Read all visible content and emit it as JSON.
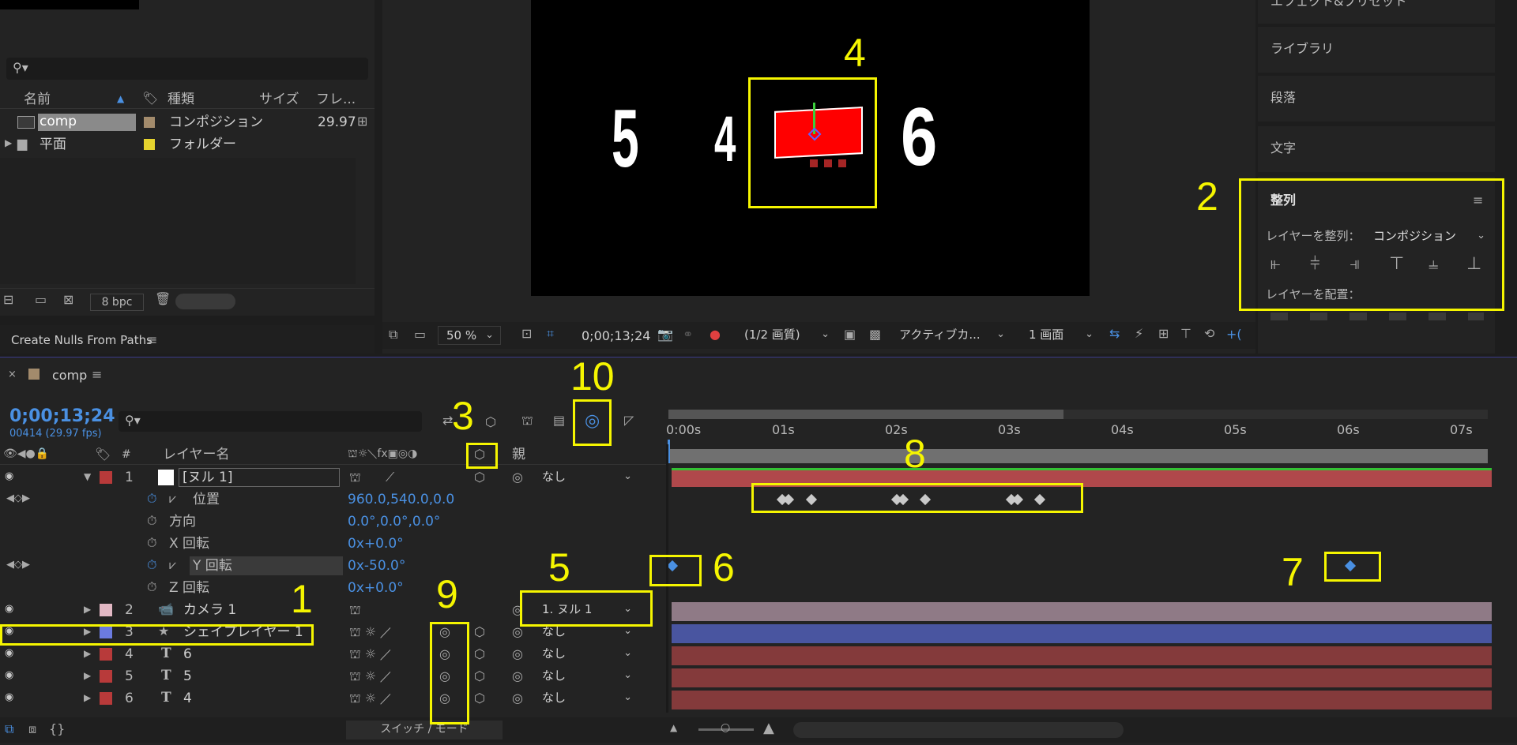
{
  "project": {
    "search_placeholder": "",
    "columns": [
      "名前",
      "種類",
      "サイズ",
      "フレ..."
    ],
    "items": [
      {
        "name": "comp",
        "type": "コンポジション",
        "fps": "29.97",
        "type_color": "#a38b6c"
      },
      {
        "name": "平面",
        "type": "フォルダー",
        "fps": "",
        "type_color": "#e5d32e"
      }
    ],
    "bpc": "8 bpc",
    "script_panel": "Create Nulls From Paths"
  },
  "viewer": {
    "texts": {
      "five": "5",
      "four": "4",
      "six": "6"
    },
    "zoom": "50 %",
    "timecode": "0;00;13;24",
    "resolution": "(1/2 画質)",
    "camera": "アクティブカ...",
    "views": "1 画面"
  },
  "right_panel": {
    "items": [
      "エフェクト&プリセット",
      "ライブラリ",
      "段落",
      "文字"
    ],
    "align": {
      "title": "整列",
      "align_to_label": "レイヤーを整列：",
      "align_to_value": "コンポジション",
      "distribute_label": "レイヤーを配置："
    }
  },
  "timeline": {
    "comp_name": "comp",
    "timecode": "0;00;13;24",
    "frame_info": "00414 (29.97 fps)",
    "layer_name_header": "レイヤー名",
    "parent_header": "親",
    "ruler": [
      "0:00s",
      "01s",
      "02s",
      "03s",
      "04s",
      "05s",
      "06s",
      "07s"
    ],
    "toggle_label": "スイッチ / モード",
    "layers": [
      {
        "num": "1",
        "name": "[ヌル 1]",
        "label_color": "#b83a3a",
        "parent": "なし",
        "bar_color": "#b0484b"
      },
      {
        "num": "2",
        "name": "カメラ 1",
        "label_color": "#e2b8c4",
        "parent": "1. ヌル 1",
        "bar_color": "#8f7a86"
      },
      {
        "num": "3",
        "name": "シェイプレイヤー 1",
        "label_color": "#6b7be0",
        "parent": "なし",
        "bar_color": "#4955a0"
      },
      {
        "num": "4",
        "name": "6",
        "label_color": "#b83a3a",
        "parent": "なし",
        "bar_color": "#843a3b"
      },
      {
        "num": "5",
        "name": "5",
        "label_color": "#b83a3a",
        "parent": "なし",
        "bar_color": "#843a3b"
      },
      {
        "num": "6",
        "name": "4",
        "label_color": "#b83a3a",
        "parent": "なし",
        "bar_color": "#843a3b"
      }
    ],
    "properties": [
      {
        "name": "位置",
        "value": "960.0,540.0,0.0"
      },
      {
        "name": "方向",
        "value": "0.0°,0.0°,0.0°"
      },
      {
        "name": "X 回転",
        "value": "0x+0.0°"
      },
      {
        "name": "Y 回転",
        "value": "0x-50.0°"
      },
      {
        "name": "Z 回転",
        "value": "0x+0.0°"
      }
    ]
  },
  "annotations": [
    "1",
    "2",
    "3",
    "4",
    "5",
    "6",
    "7",
    "8",
    "9",
    "10"
  ]
}
